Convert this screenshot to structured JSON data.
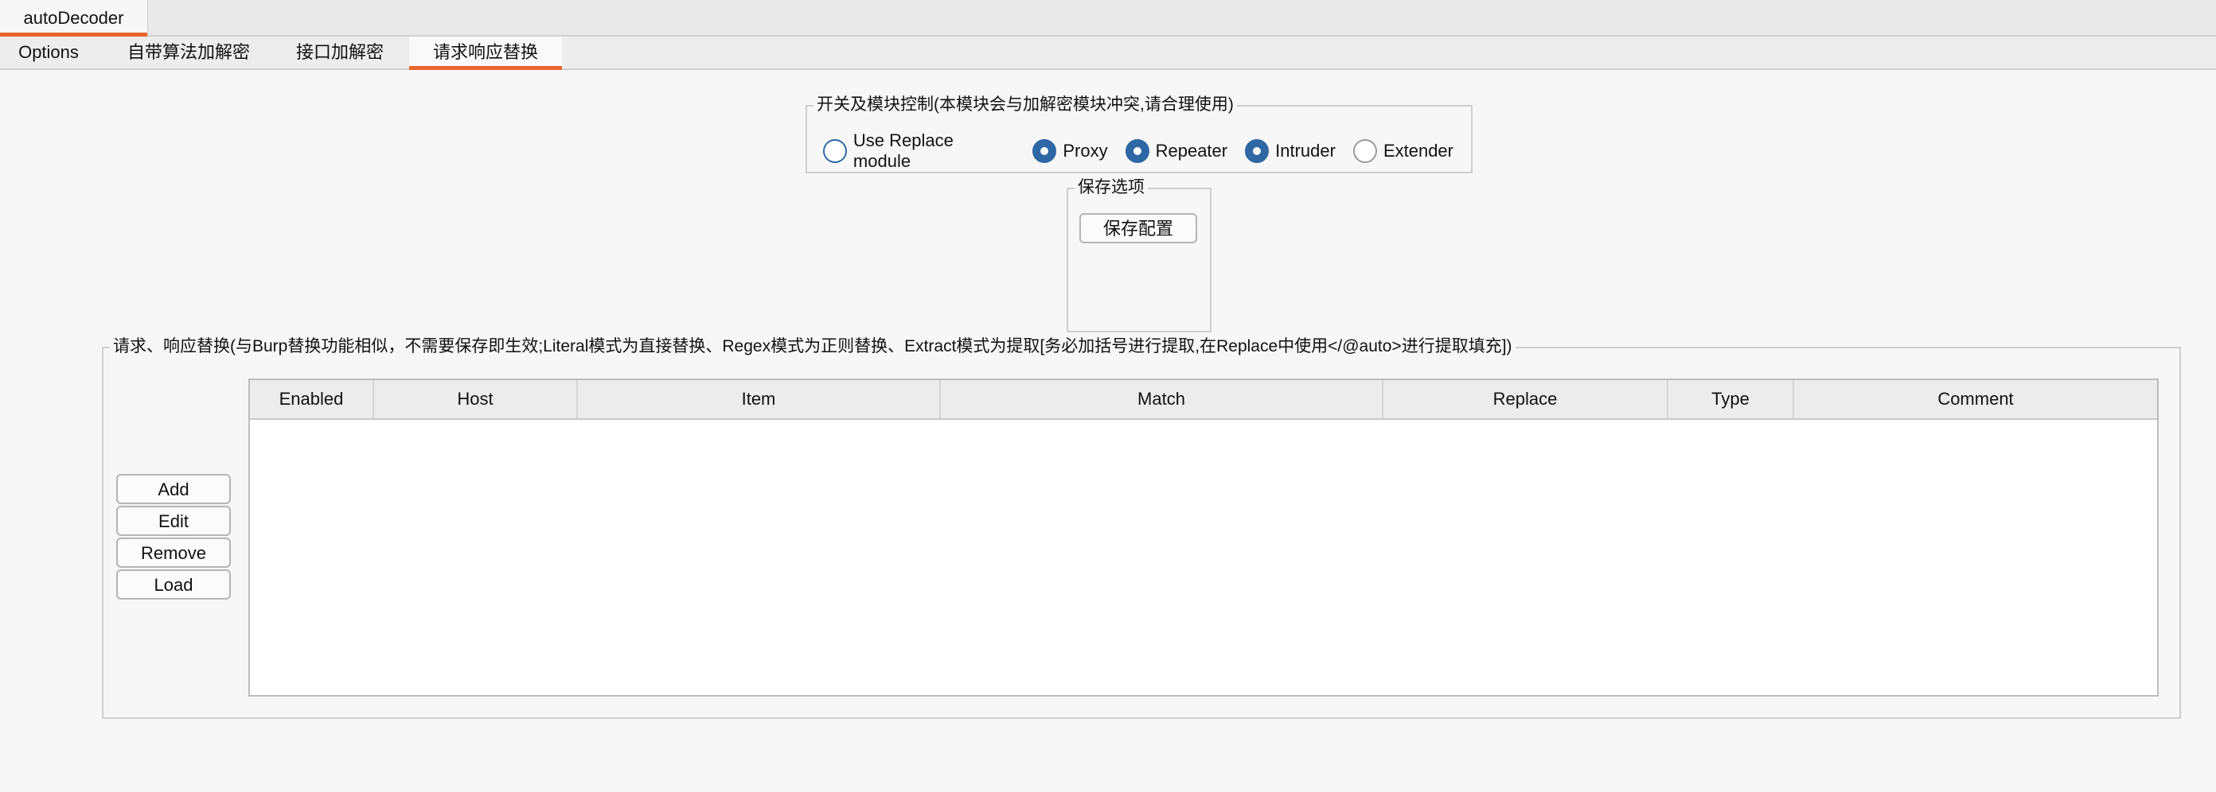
{
  "window": {
    "top_tab": "autoDecoder"
  },
  "subtabs": [
    {
      "label": "Options"
    },
    {
      "label": "自带算法加解密"
    },
    {
      "label": "接口加解密"
    },
    {
      "label": "请求响应替换"
    }
  ],
  "module_control": {
    "legend": "开关及模块控制(本模块会与加解密模块冲突,请合理使用)",
    "options": [
      {
        "label": "Use Replace module",
        "checked": false
      },
      {
        "label": "Proxy",
        "checked": true
      },
      {
        "label": "Repeater",
        "checked": true
      },
      {
        "label": "Intruder",
        "checked": true
      },
      {
        "label": "Extender",
        "checked": false
      }
    ]
  },
  "save_options": {
    "legend": "保存选项",
    "save_button": "保存配置"
  },
  "replace_group": {
    "legend": "请求、响应替换(与Burp替换功能相似，不需要保存即生效;Literal模式为直接替换、Regex模式为正则替换、Extract模式为提取[务必加括号进行提取,在Replace中使用</@auto>进行提取填充])",
    "buttons": {
      "add": "Add",
      "edit": "Edit",
      "remove": "Remove",
      "load": "Load"
    },
    "table": {
      "columns": [
        "Enabled",
        "Host",
        "Item",
        "Match",
        "Replace",
        "Type",
        "Comment"
      ],
      "rows": []
    }
  }
}
